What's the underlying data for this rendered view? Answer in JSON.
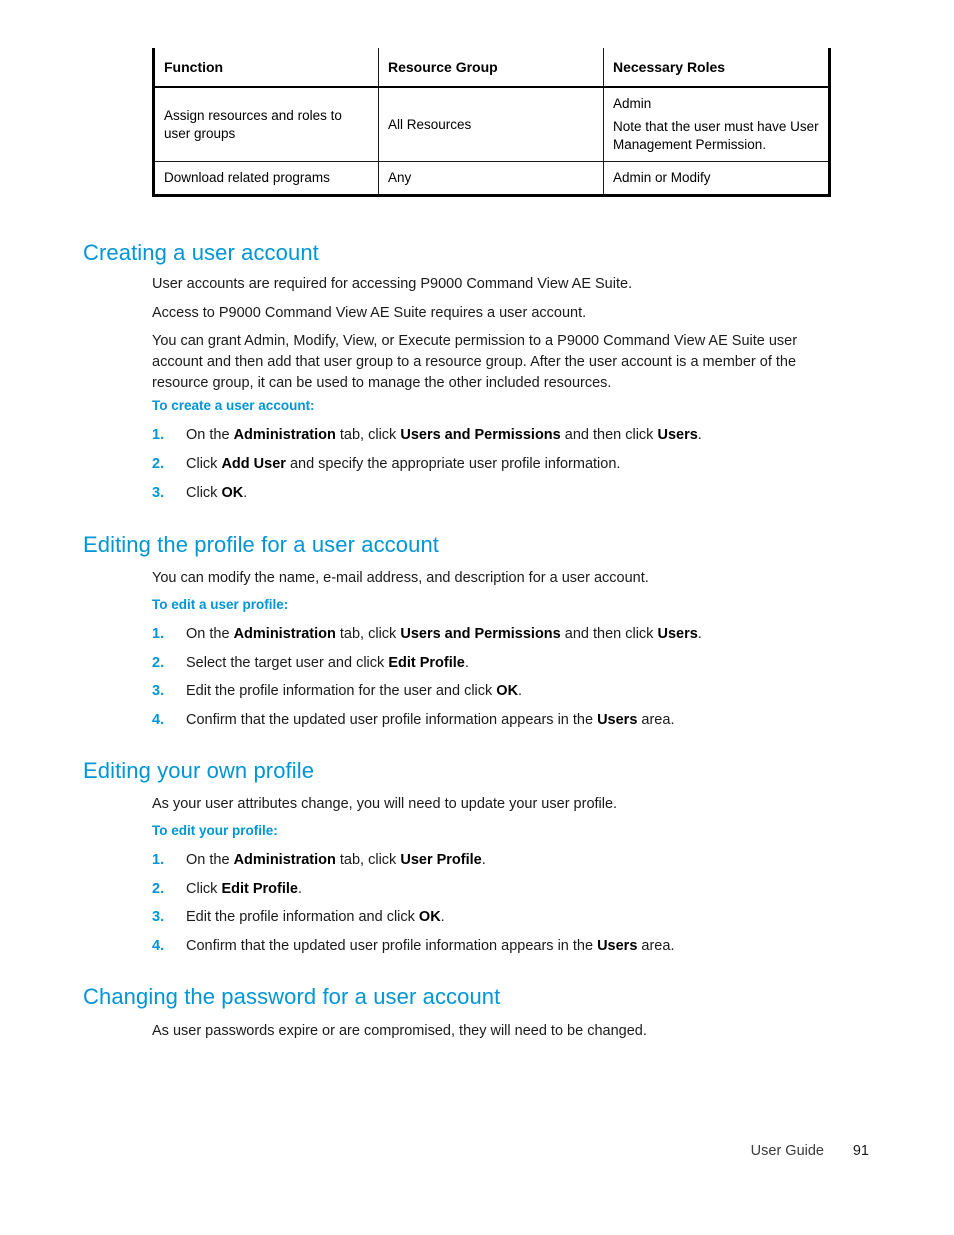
{
  "document": {
    "title": "User Guide",
    "page_number": "91",
    "accent_color": "#0096d6",
    "text_color": "#1a1a1a"
  },
  "table": {
    "headers": [
      "Function",
      "Resource Group",
      "Necessary Roles"
    ],
    "rows": [
      {
        "function": "Assign resources and roles to user groups",
        "resource_group": "All Resources",
        "roles_line1": "Admin",
        "roles_line2": "Note that the user must have User Management Permission."
      },
      {
        "function": "Download related programs",
        "resource_group": "Any",
        "roles_line1": "Admin or Modify",
        "roles_line2": ""
      }
    ]
  },
  "sections": [
    {
      "heading": "Creating a user account",
      "paragraphs": [
        "User accounts are required for accessing P9000 Command View AE Suite.",
        "Access to P9000 Command View AE Suite requires a user account.",
        "You can grant Admin, Modify, View, or Execute permission to a P9000 Command View AE Suite user account and then add that user group to a resource group. After the user account is a member of the resource group, it can be used to manage the other included resources."
      ],
      "subheading": "To create a user account:",
      "steps": [
        {
          "num": "1.",
          "pre": "On the ",
          "b1": "Administration",
          "mid1": " tab, click ",
          "b2": "Users and Permissions",
          "mid2": " and then click ",
          "b3": "Users",
          "post": "."
        },
        {
          "num": "2.",
          "pre": "Click ",
          "b1": "Add User",
          "mid1": " and specify the appropriate user profile information.",
          "b2": "",
          "mid2": "",
          "b3": "",
          "post": ""
        },
        {
          "num": "3.",
          "pre": "Click ",
          "b1": "OK",
          "mid1": ".",
          "b2": "",
          "mid2": "",
          "b3": "",
          "post": ""
        }
      ]
    },
    {
      "heading": "Editing the profile for a user account",
      "paragraphs": [
        "You can modify the name, e-mail address, and description for a user account."
      ],
      "subheading": "To edit a user profile:",
      "steps": [
        {
          "num": "1.",
          "pre": "On the ",
          "b1": "Administration",
          "mid1": " tab, click ",
          "b2": "Users and Permissions",
          "mid2": " and then click ",
          "b3": "Users",
          "post": "."
        },
        {
          "num": "2.",
          "pre": "Select the target user and click ",
          "b1": "Edit Profile",
          "mid1": ".",
          "b2": "",
          "mid2": "",
          "b3": "",
          "post": ""
        },
        {
          "num": "3.",
          "pre": "Edit the profile information for the user and click ",
          "b1": "OK",
          "mid1": ".",
          "b2": "",
          "mid2": "",
          "b3": "",
          "post": ""
        },
        {
          "num": "4.",
          "pre": "Confirm that the updated user profile information appears in the ",
          "b1": "Users",
          "mid1": " area.",
          "b2": "",
          "mid2": "",
          "b3": "",
          "post": ""
        }
      ]
    },
    {
      "heading": "Editing your own profile",
      "paragraphs": [
        "As your user attributes change, you will need to update your user profile."
      ],
      "subheading": "To edit your profile:",
      "steps": [
        {
          "num": "1.",
          "pre": "On the ",
          "b1": "Administration",
          "mid1": " tab, click ",
          "b2": "User Profile",
          "mid2": ".",
          "b3": "",
          "post": ""
        },
        {
          "num": "2.",
          "pre": "Click ",
          "b1": "Edit Profile",
          "mid1": ".",
          "b2": "",
          "mid2": "",
          "b3": "",
          "post": ""
        },
        {
          "num": "3.",
          "pre": "Edit the profile information and click ",
          "b1": "OK",
          "mid1": ".",
          "b2": "",
          "mid2": "",
          "b3": "",
          "post": ""
        },
        {
          "num": "4.",
          "pre": "Confirm that the updated user profile information appears in the ",
          "b1": "Users",
          "mid1": " area.",
          "b2": "",
          "mid2": "",
          "b3": "",
          "post": ""
        }
      ]
    },
    {
      "heading": "Changing the password for a user account",
      "paragraphs": [
        "As user passwords expire or are compromised, they will need to be changed."
      ],
      "subheading": "",
      "steps": []
    }
  ]
}
